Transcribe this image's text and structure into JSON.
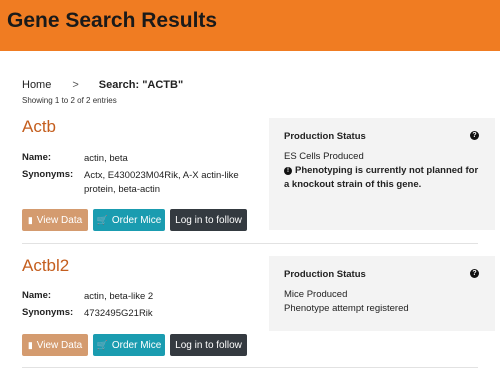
{
  "header": {
    "title": "Gene Search Results"
  },
  "breadcrumb": {
    "home": "Home",
    "separator": ">",
    "current": "Search: \"ACTB\""
  },
  "results_summary": "Showing 1 to 2 of 2 entries",
  "labels": {
    "name": "Name:",
    "synonyms": "Synonyms:"
  },
  "buttons": {
    "view_data": "View Data",
    "order_mice": "Order Mice",
    "login_follow": "Log in to follow",
    "view_data_icon": "bar-chart-icon",
    "order_mice_icon": "shopping-cart-icon"
  },
  "genes": [
    {
      "symbol": "Actb",
      "name": "actin, beta",
      "synonyms": "Actx, E430023M04Rik, A-X actin-like protein, beta-actin",
      "status_title": "Production Status",
      "status_help": "?",
      "status_lines": [
        "ES Cells Produced"
      ],
      "warning_icon": "!",
      "warning": "Phenotyping is currently not planned for a knockout strain of this gene."
    },
    {
      "symbol": "Actbl2",
      "name": "actin, beta-like 2",
      "synonyms": "4732495G21Rik",
      "status_title": "Production Status",
      "status_help": "?",
      "status_lines": [
        "Mice Produced",
        "Phenotype attempt registered"
      ]
    }
  ],
  "colors": {
    "header": "#f07c22",
    "gene_link": "#c45e1e",
    "view_data": "#d49b6f",
    "order_mice": "#1a9cb0",
    "login": "#343a40",
    "status_panel": "#f3f3f3"
  }
}
